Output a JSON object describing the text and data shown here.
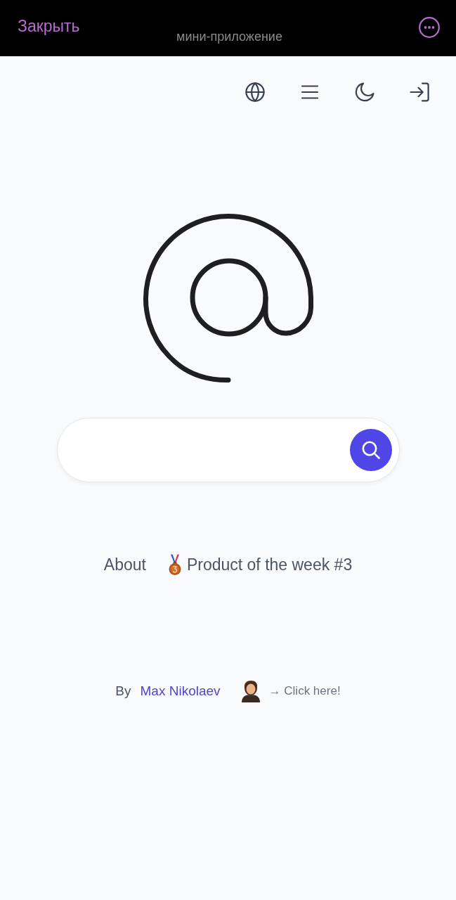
{
  "top_bar": {
    "close_label": "Закрыть",
    "title": "мини-приложение"
  },
  "links": [
    {
      "kind": "plain",
      "label": "About"
    },
    {
      "kind": "award",
      "label": "Product of the week #3"
    }
  ],
  "footer": {
    "by_label": "By",
    "author": "Max Nikolaev",
    "cta": "→ Click here!"
  }
}
